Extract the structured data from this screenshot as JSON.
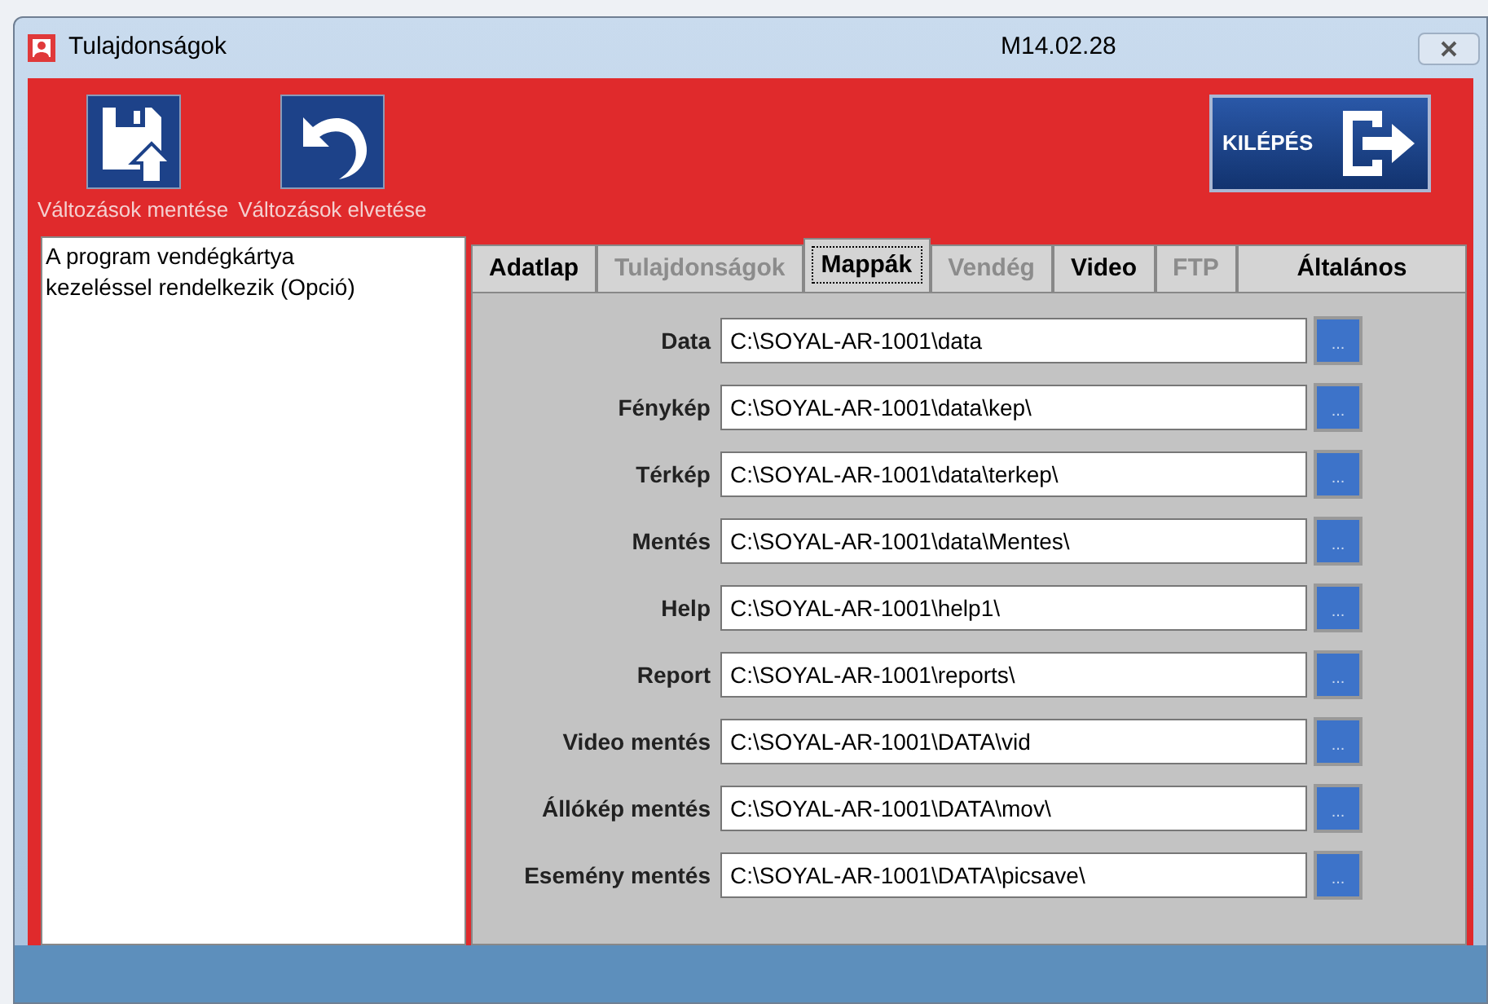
{
  "window": {
    "title": "Tulajdonságok",
    "version": "M14.02.28"
  },
  "toolbar": {
    "buttons": [
      {
        "kind": "save",
        "label": "Változások mentése"
      },
      {
        "kind": "undo",
        "label": "Változások elvetése"
      }
    ],
    "exit": {
      "label": "KILÉPÉS"
    }
  },
  "info_text": "A program vendégkártya kezeléssel rendelkezik (Opció)",
  "tabs": [
    {
      "label": "Adatlap",
      "selected": false,
      "disabled": false
    },
    {
      "label": "Tulajdonságok",
      "selected": false,
      "disabled": true
    },
    {
      "label": "Mappák",
      "selected": true,
      "disabled": false
    },
    {
      "label": "Vendég",
      "selected": false,
      "disabled": true
    },
    {
      "label": "Video",
      "selected": false,
      "disabled": false
    },
    {
      "label": "FTP",
      "selected": false,
      "disabled": true
    },
    {
      "label": "Általános",
      "selected": false,
      "disabled": false
    }
  ],
  "folders": [
    {
      "label": "Data",
      "value": "C:\\SOYAL-AR-1001\\data",
      "browse": "..."
    },
    {
      "label": "Fénykép",
      "value": "C:\\SOYAL-AR-1001\\data\\kep\\",
      "browse": "..."
    },
    {
      "label": "Térkép",
      "value": "C:\\SOYAL-AR-1001\\data\\terkep\\",
      "browse": "..."
    },
    {
      "label": "Mentés",
      "value": "C:\\SOYAL-AR-1001\\data\\Mentes\\",
      "browse": "..."
    },
    {
      "label": "Help",
      "value": "C:\\SOYAL-AR-1001\\help1\\",
      "browse": "..."
    },
    {
      "label": "Report",
      "value": "C:\\SOYAL-AR-1001\\reports\\",
      "browse": "..."
    },
    {
      "label": "Video mentés",
      "value": "C:\\SOYAL-AR-1001\\DATA\\vid",
      "browse": "..."
    },
    {
      "label": "Állókép mentés",
      "value": "C:\\SOYAL-AR-1001\\DATA\\mov\\",
      "browse": "..."
    },
    {
      "label": "Esemény mentés",
      "value": "C:\\SOYAL-AR-1001\\DATA\\picsave\\",
      "browse": "..."
    }
  ]
}
